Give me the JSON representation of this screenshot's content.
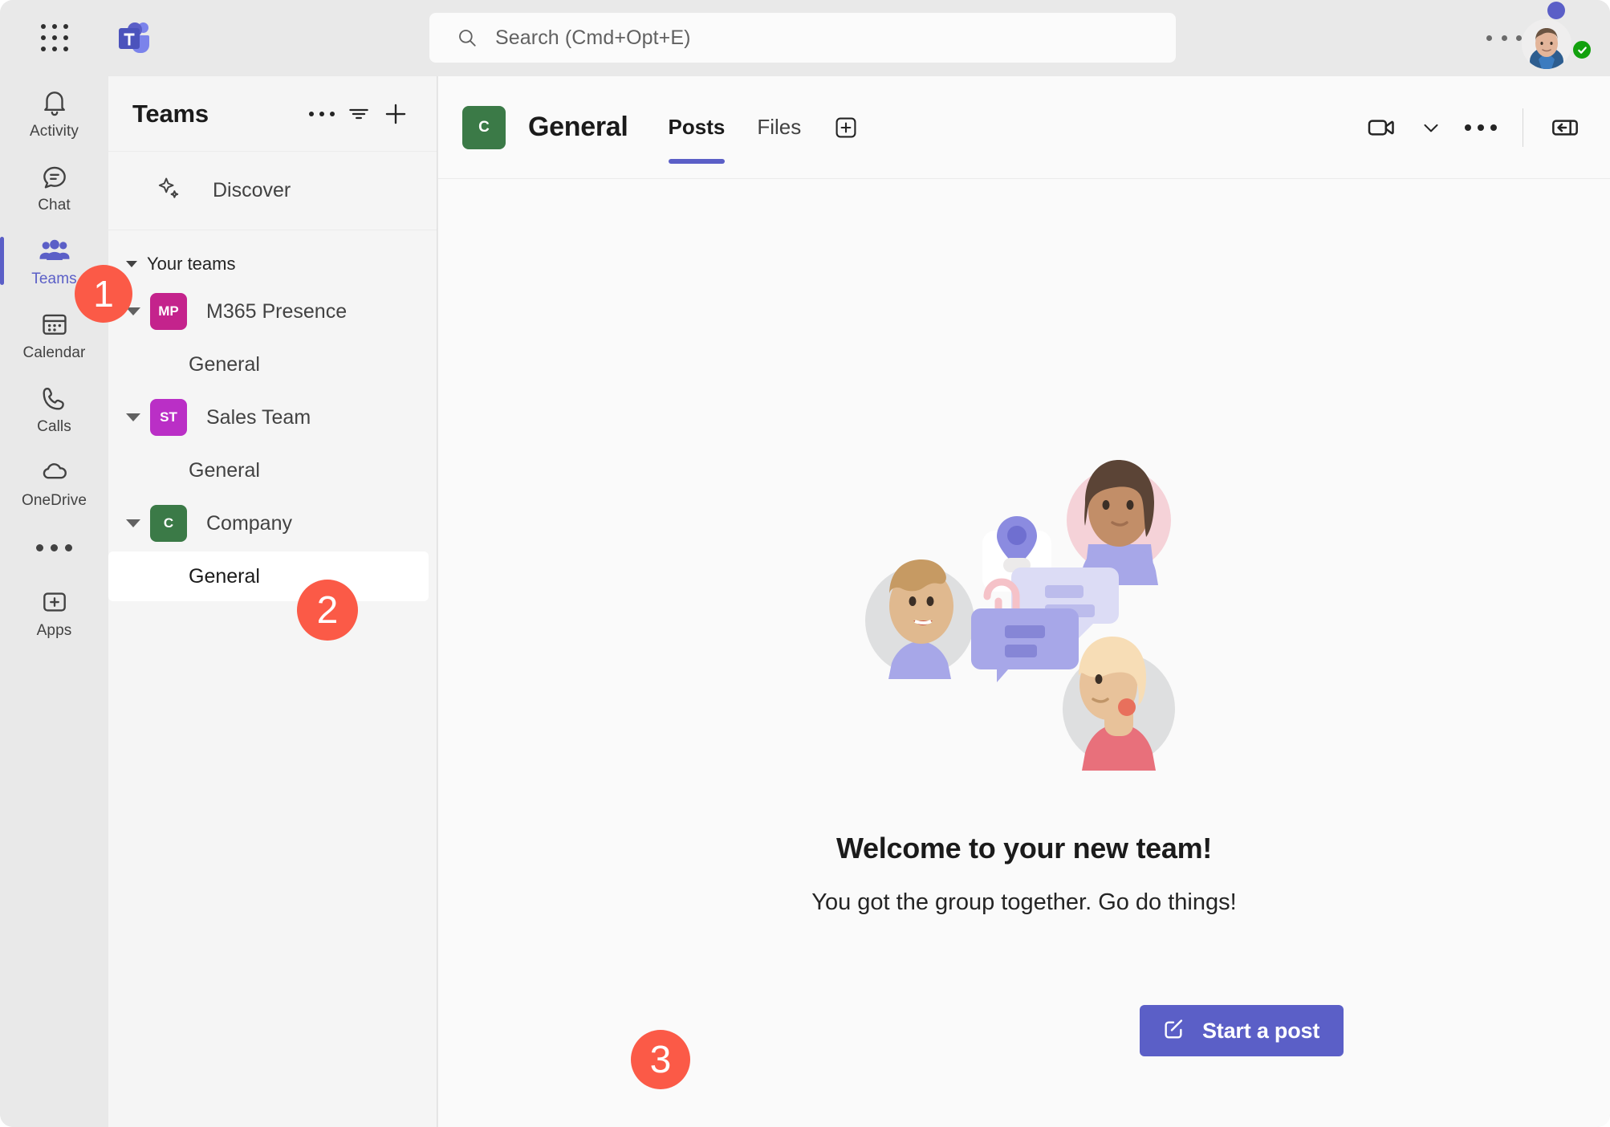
{
  "app": {
    "title": "Microsoft Teams",
    "accent_color": "#5b5fc7",
    "callout_color": "#fb5a47"
  },
  "topbar": {
    "waffle_label": "app-launcher",
    "logo_label": "Microsoft Teams",
    "search": {
      "placeholder": "Search (Cmd+Opt+E)",
      "value": "",
      "icon": "search-icon"
    },
    "more_label": "Settings and more",
    "avatar_label": "Account manager",
    "presence_status": "Available"
  },
  "rail": {
    "items": [
      {
        "label": "Activity",
        "icon": "bell-icon",
        "active": false
      },
      {
        "label": "Chat",
        "icon": "chat-icon",
        "active": false
      },
      {
        "label": "Teams",
        "icon": "people-icon",
        "active": true
      },
      {
        "label": "Calendar",
        "icon": "calendar-icon",
        "active": false
      },
      {
        "label": "Calls",
        "icon": "phone-icon",
        "active": false
      },
      {
        "label": "OneDrive",
        "icon": "cloud-icon",
        "active": false
      }
    ],
    "more_label": "More apps",
    "apps": {
      "label": "Apps",
      "icon": "plus-box-icon"
    }
  },
  "teams_panel": {
    "title": "Teams",
    "more_label": "Teams options",
    "filter_label": "Filter",
    "add_label": "Join or create a team",
    "discover": {
      "label": "Discover",
      "icon": "sparkle-icon"
    },
    "section": {
      "label": "Your teams",
      "expanded": true
    },
    "teams": [
      {
        "name": "M365 Presence",
        "initials": "MP",
        "color": "#c4238c",
        "expanded": true,
        "channels": [
          {
            "name": "General",
            "selected": false
          }
        ]
      },
      {
        "name": "Sales Team",
        "initials": "ST",
        "color": "#ba2fc6",
        "expanded": true,
        "channels": [
          {
            "name": "General",
            "selected": false
          }
        ]
      },
      {
        "name": "Company",
        "initials": "C",
        "color": "#3b7a47",
        "expanded": true,
        "channels": [
          {
            "name": "General",
            "selected": true
          }
        ]
      }
    ]
  },
  "channel": {
    "team_initials": "C",
    "team_color": "#3b7a47",
    "name": "General",
    "tabs": [
      {
        "label": "Posts",
        "active": true
      },
      {
        "label": "Files",
        "active": false
      }
    ],
    "add_tab_label": "Add a tab",
    "meet_label": "Meet",
    "meet_chevron_label": "Meet options",
    "more_label": "More options",
    "expand_label": "Open chat details"
  },
  "welcome": {
    "title": "Welcome to your new team!",
    "subtitle": "You got the group together. Go do things!",
    "start_post_label": "Start a post",
    "start_post_icon": "compose-icon",
    "illustration_label": "team-collaboration-illustration"
  },
  "callouts": [
    {
      "number": "1",
      "target": "rail-item-teams"
    },
    {
      "number": "2",
      "target": "channel-general-company"
    },
    {
      "number": "3",
      "target": "start-post-button"
    }
  ]
}
